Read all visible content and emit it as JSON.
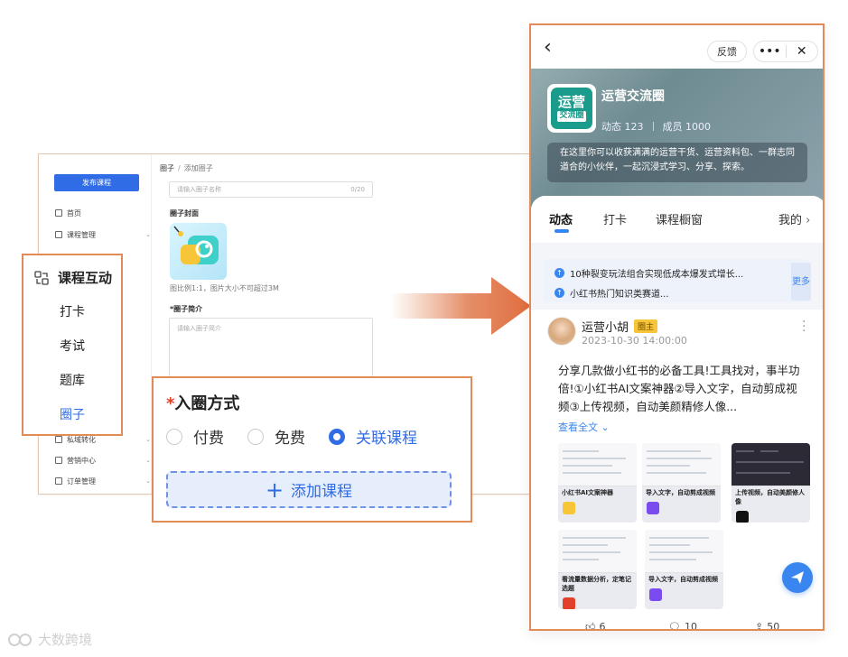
{
  "admin": {
    "publish_button": "发布课程",
    "sidebar": [
      {
        "label": "首页",
        "icon": "home-icon"
      },
      {
        "label": "课程管理",
        "icon": "course-icon"
      },
      {
        "label": "私域转化",
        "icon": "convert-icon"
      },
      {
        "label": "营销中心",
        "icon": "marketing-icon"
      },
      {
        "label": "订单管理",
        "icon": "order-icon"
      }
    ],
    "breadcrumb": {
      "parent": "圈子",
      "separator": "/",
      "current": "添加圈子"
    },
    "name_input": {
      "placeholder": "请输入圈子名称",
      "counter": "0/20"
    },
    "cover_label": "圈子封面",
    "cover_hint": "图比例1:1，图片大小不可超过3M",
    "intro_label": "*圈子简介",
    "intro_placeholder": "请输入圈子简介"
  },
  "zoom_menu": {
    "title": "课程互动",
    "items": [
      "打卡",
      "考试",
      "题库",
      "圈子"
    ],
    "active": "圈子"
  },
  "zoom_join": {
    "required_mark": "*",
    "title": "入圈方式",
    "options": [
      "付费",
      "免费",
      "关联课程"
    ],
    "selected": "关联课程",
    "add_button": "添加课程"
  },
  "phone": {
    "feedback": "反馈",
    "more": "•••",
    "close": "✕",
    "logo_line1": "运营",
    "logo_line2": "交流圈",
    "group_name": "运营交流圈",
    "posts_label": "动态 123",
    "members_label": "成员 1000",
    "description": "在这里你可以收获满满的运营干货、运营资料包、一群志同道合的小伙伴，一起沉浸式学习、分享、探索。",
    "tabs": [
      "动态",
      "打卡",
      "课程橱窗",
      "我的"
    ],
    "active_tab": "动态",
    "notices": [
      "10种裂变玩法组合实现低成本爆发式增长...",
      "小红书热门知识类赛道..."
    ],
    "notice_more": "更多",
    "post": {
      "author": "运营小胡",
      "badge": "圈主",
      "time": "2023-10-30 14:00:00",
      "content": "分享几款做小红书的必备工具!工具找对，事半功倍!①小红书AI文案神器②导入文字，自动剪成视频③上传视频，自动美颜精修人像...",
      "expand": "查看全文",
      "thumbs": [
        {
          "caption": "小红书AI文案神器",
          "dark": false,
          "icon_color": "#f6c638"
        },
        {
          "caption": "导入文字，自动剪成视频",
          "dark": false,
          "icon_color": "#7a4cf0"
        },
        {
          "caption": "上传视频，自动美颜修人像",
          "dark": true,
          "icon_color": "#111111"
        },
        {
          "caption": "看流量数据分析，定笔记选题",
          "dark": false,
          "icon_color": "#e2402a"
        },
        {
          "caption": "导入文字，自动剪成视频",
          "dark": false,
          "icon_color": "#7a4cf0"
        }
      ],
      "likes": "6",
      "comments": "10",
      "shares": "50"
    }
  },
  "watermark": "大数跨境",
  "colors": {
    "accent": "#2f6ce5",
    "callout_border": "#e28a5a",
    "phone_accent": "#3a86f0"
  }
}
